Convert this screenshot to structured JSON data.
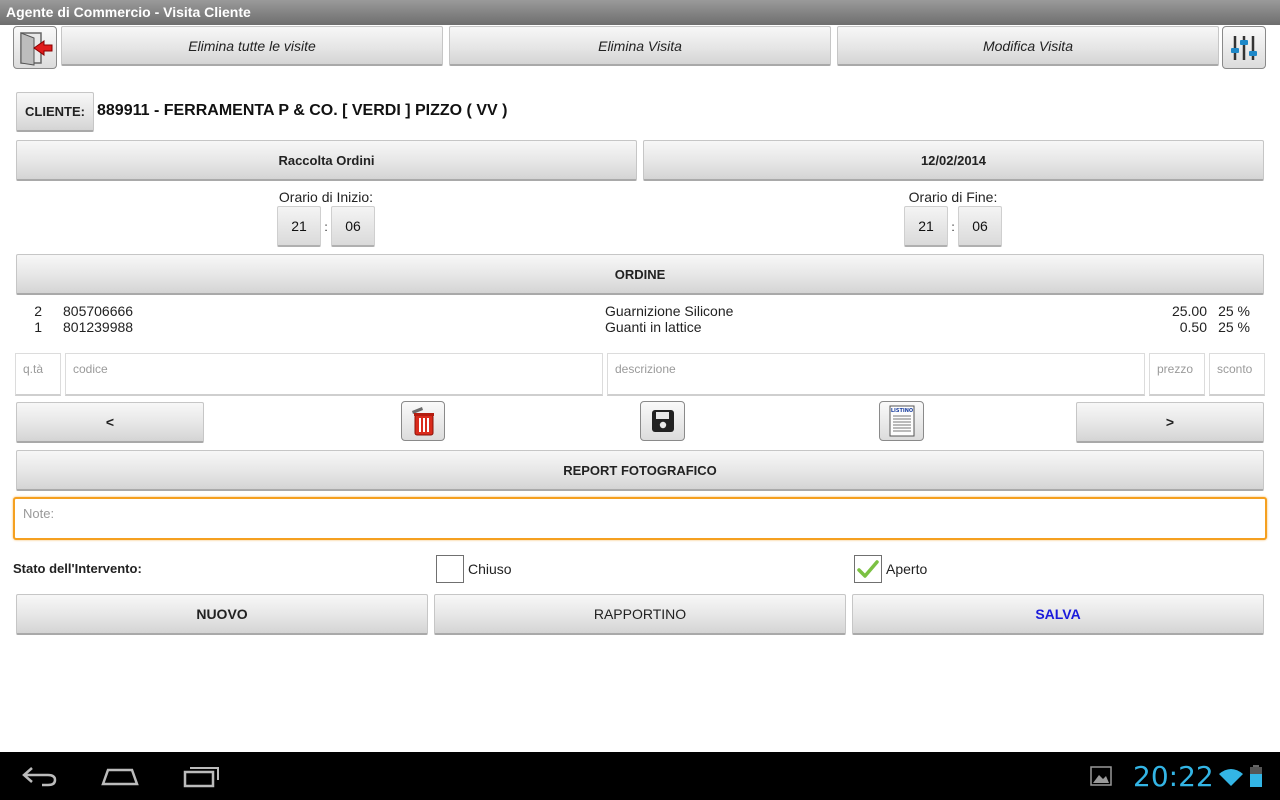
{
  "app": {
    "title": "Agente di Commercio - Visita Cliente"
  },
  "toolbar": {
    "delete_all_label": "Elimina tutte le visite",
    "delete_visit_label": "Elimina Visita",
    "edit_visit_label": "Modifica Visita"
  },
  "client": {
    "button_label": "CLIENTE:",
    "name": "889911 - FERRAMENTA P & CO. [ VERDI ] PIZZO ( VV )"
  },
  "visit": {
    "type_label": "Raccolta Ordini",
    "date": "12/02/2014",
    "start": {
      "label": "Orario di Inizio:",
      "hour": "21",
      "sep": ":",
      "minute": "06"
    },
    "end": {
      "label": "Orario di Fine:",
      "hour": "21",
      "sep": ":",
      "minute": "06"
    }
  },
  "order": {
    "header": "ORDINE",
    "rows": [
      {
        "qty": "2",
        "code": "805706666",
        "desc": "Guarnizione Silicone",
        "price": "25.00",
        "discount": "25 %"
      },
      {
        "qty": "1",
        "code": "801239988",
        "desc": "Guanti in lattice",
        "price": "0.50",
        "discount": "25 %"
      }
    ],
    "placeholders": {
      "qty": "q.tà",
      "code": "codice",
      "desc": "descrizione",
      "price": "prezzo",
      "discount": "sconto"
    },
    "prev_label": "<",
    "next_label": ">",
    "listino_label": "LISTINO"
  },
  "report_label": "REPORT FOTOGRAFICO",
  "note_placeholder": "Note:",
  "status": {
    "label": "Stato dell'Intervento:",
    "closed_label": "Chiuso",
    "closed_checked": false,
    "open_label": "Aperto",
    "open_checked": true
  },
  "actions": {
    "new_label": "NUOVO",
    "report_label": "RAPPORTINO",
    "save_label": "SALVA",
    "save_color": "#1a1adb"
  },
  "systembar": {
    "clock": "20:22",
    "clock_color": "#33b5e5"
  },
  "icons": [
    "exit-icon",
    "settings-sliders-icon",
    "trash-icon",
    "save-disk-icon",
    "listino-icon",
    "back-icon",
    "home-icon",
    "recent-apps-icon",
    "gallery-icon",
    "wifi-icon",
    "battery-icon"
  ]
}
